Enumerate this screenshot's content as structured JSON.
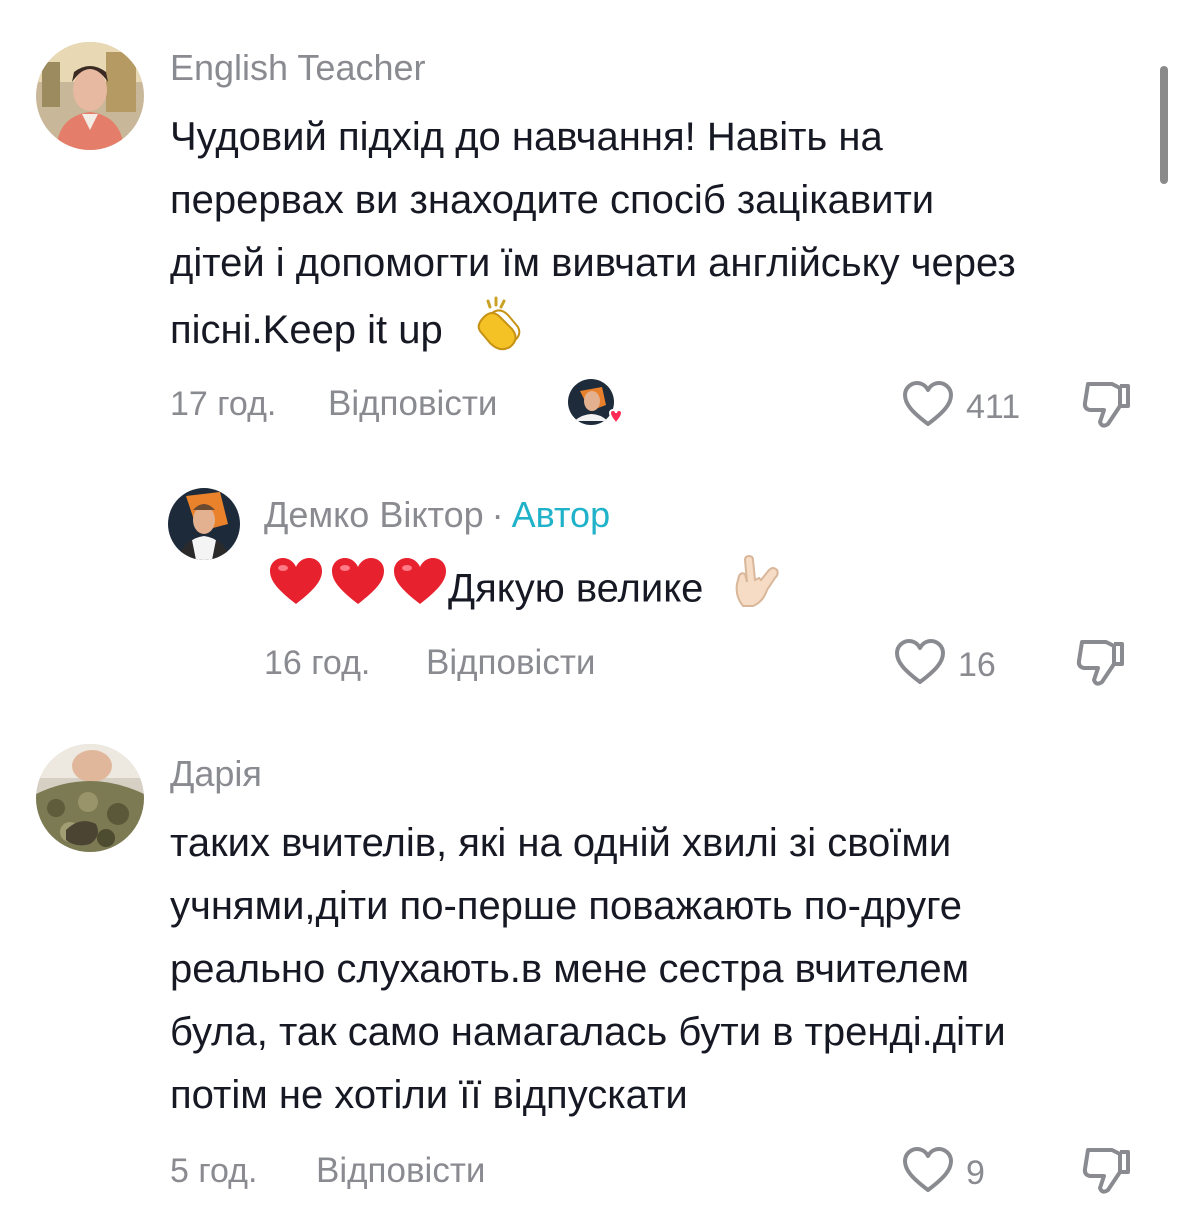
{
  "comments": [
    {
      "author": "English Teacher",
      "text_lines": [
        "Чудовий підхід до навчання! Навіть на",
        "перервах ви знаходите спосіб зацікавити",
        "дітей і допомогти їм вивчати англійську через",
        "пісні.Keep it up"
      ],
      "emoji": "clapping-hands",
      "time": "17 год.",
      "reply_label": "Відповісти",
      "likes": "411",
      "liked_by_creator": true
    },
    {
      "author": "Демко Віктор",
      "badge_separator": "·",
      "badge": "Автор",
      "text": "Дякую велике",
      "emoji_prefix": [
        "red-heart",
        "red-heart",
        "red-heart"
      ],
      "emoji_suffix": "love-you-gesture",
      "time": "16 год.",
      "reply_label": "Відповісти",
      "likes": "16"
    },
    {
      "author": "Дарія",
      "text_lines": [
        "таких вчителів, які на одній хвилі зі своїми",
        "учнями,діти по-перше поважають по-друге",
        "реально слухають.в мене сестра вчителем",
        "була, так само намагалась бути в тренді.діти",
        "потім не хотіли її відпускати"
      ],
      "time": "5 год.",
      "reply_label": "Відповісти",
      "likes": "9"
    }
  ],
  "colors": {
    "text": "#161823",
    "muted": "#8a8b91",
    "author_badge": "#20b2c9",
    "heart_red": "#fe2c55"
  }
}
